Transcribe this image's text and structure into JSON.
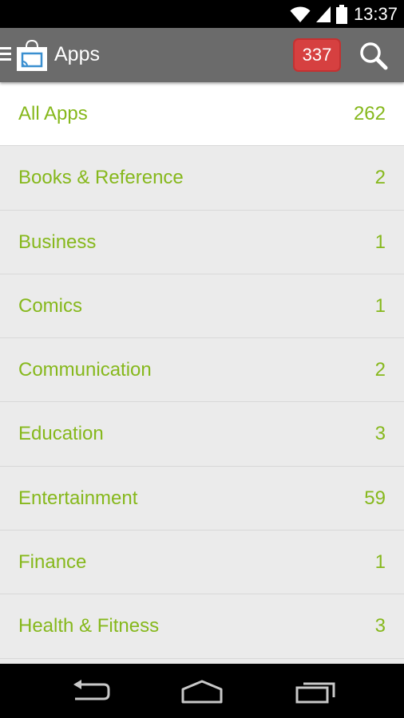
{
  "status_bar": {
    "time": "13:37",
    "icons": [
      "wifi-icon",
      "signal-icon",
      "battery-icon"
    ]
  },
  "action_bar": {
    "title": "Apps",
    "badge_count": "337",
    "icons": [
      "menu-icon",
      "shopping-bag-app-icon",
      "search-icon"
    ]
  },
  "categories": [
    {
      "label": "All Apps",
      "count": "262",
      "selected": true
    },
    {
      "label": "Books & Reference",
      "count": "2"
    },
    {
      "label": "Business",
      "count": "1"
    },
    {
      "label": "Comics",
      "count": "1"
    },
    {
      "label": "Communication",
      "count": "2"
    },
    {
      "label": "Education",
      "count": "3"
    },
    {
      "label": "Entertainment",
      "count": "59"
    },
    {
      "label": "Finance",
      "count": "1"
    },
    {
      "label": "Health & Fitness",
      "count": "3"
    }
  ],
  "nav_bar": {
    "icons": [
      "back-icon",
      "home-icon",
      "recents-icon"
    ]
  },
  "colors": {
    "accent_green": "#86b81c",
    "action_bar": "#6b6b6b",
    "badge_red": "#d64040",
    "list_bg": "#ebebeb",
    "selected_bg": "#ffffff"
  }
}
